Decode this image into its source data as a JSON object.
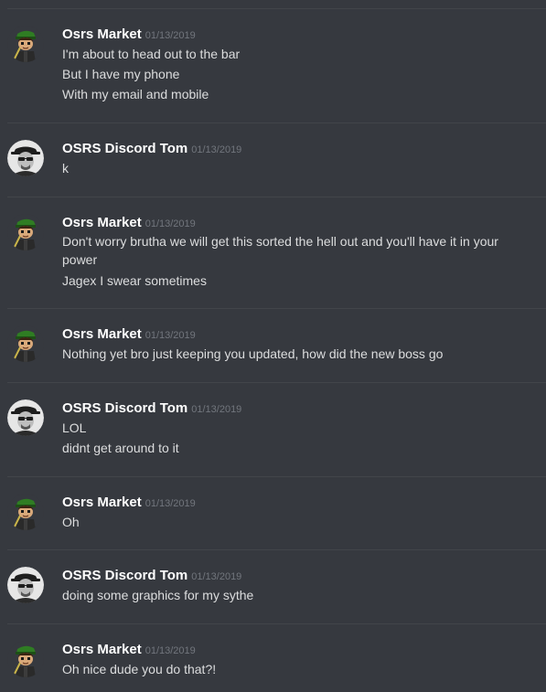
{
  "messages": [
    {
      "author": "Osrs Market",
      "avatar": "green-cap-character-icon",
      "timestamp": "01/13/2019",
      "lines": [
        "I'm about to head out to the bar",
        "But I have my phone",
        "With my email and mobile"
      ]
    },
    {
      "author": "OSRS Discord Tom",
      "avatar": "bald-man-sunglasses-icon",
      "timestamp": "01/13/2019",
      "lines": [
        "k"
      ]
    },
    {
      "author": "Osrs Market",
      "avatar": "green-cap-character-icon",
      "timestamp": "01/13/2019",
      "lines": [
        "Don't worry brutha we will get this sorted the hell out and you'll have it in your power",
        "Jagex I swear sometimes"
      ]
    },
    {
      "author": "Osrs Market",
      "avatar": "green-cap-character-icon",
      "timestamp": "01/13/2019",
      "lines": [
        "Nothing yet bro just keeping you updated, how did the new boss go"
      ]
    },
    {
      "author": "OSRS Discord Tom",
      "avatar": "bald-man-sunglasses-icon",
      "timestamp": "01/13/2019",
      "lines": [
        "LOL",
        "didnt get around to it"
      ]
    },
    {
      "author": "Osrs Market",
      "avatar": "green-cap-character-icon",
      "timestamp": "01/13/2019",
      "lines": [
        "Oh"
      ]
    },
    {
      "author": "OSRS Discord Tom",
      "avatar": "bald-man-sunglasses-icon",
      "timestamp": "01/13/2019",
      "lines": [
        "doing some graphics for my sythe"
      ]
    },
    {
      "author": "Osrs Market",
      "avatar": "green-cap-character-icon",
      "timestamp": "01/13/2019",
      "lines": [
        "Oh nice dude you do that?!"
      ]
    }
  ],
  "colors": {
    "background": "#36393f",
    "divider": "#42454a",
    "author": "#ffffff",
    "timestamp": "#72767d",
    "text": "#dcddde"
  }
}
